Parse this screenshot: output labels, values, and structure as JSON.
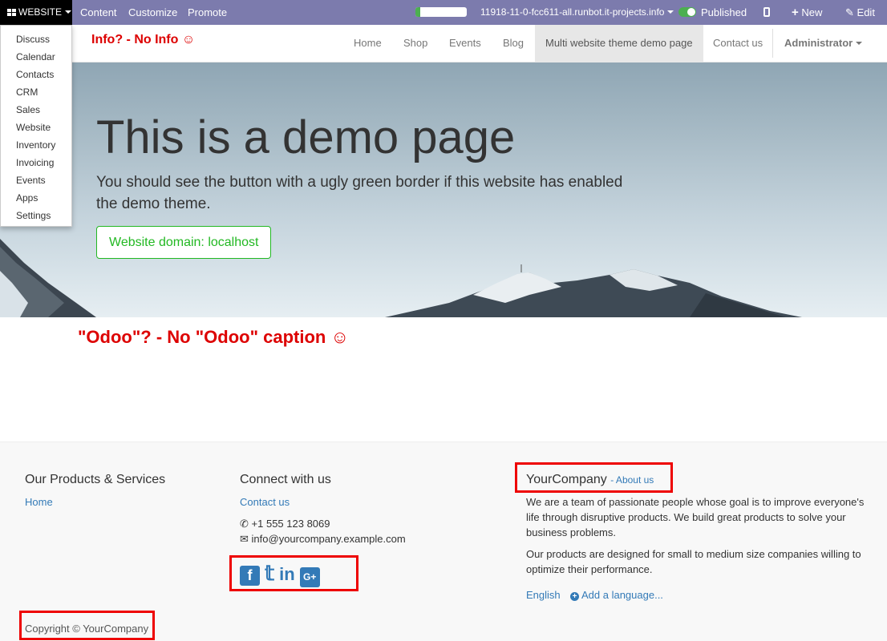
{
  "adminbar": {
    "apps_label": "WEBSITE",
    "menu": [
      "Content",
      "Customize",
      "Promote"
    ],
    "progress": 0.1,
    "domain": "11918-11-0-fcc611-all.runbot.it-projects.info",
    "published": "Published",
    "new": "New",
    "edit": "Edit"
  },
  "appmenu": [
    "Discuss",
    "Calendar",
    "Contacts",
    "CRM",
    "Sales",
    "Website",
    "Inventory",
    "Invoicing",
    "Events",
    "Apps",
    "Settings"
  ],
  "annotation_top": "Info? - No Info ☺",
  "nav": {
    "items": [
      "Home",
      "Shop",
      "Events",
      "Blog",
      "Multi website theme demo page",
      "Contact us"
    ],
    "admin": "Administrator"
  },
  "hero": {
    "title": "This is a demo page",
    "lead": "You should see the button with a ugly green border if this website has enabled the demo theme.",
    "button": "Website domain: localhost"
  },
  "annotation_middle": "\"Odoo\"? - No \"Odoo\" caption ☺",
  "footer": {
    "products_title": "Our Products & Services",
    "products_link": "Home",
    "connect_title": "Connect with us",
    "contact_link": "Contact us",
    "phone": "+1 555 123 8069",
    "email": "info@yourcompany.example.com",
    "company_title": "YourCompany",
    "about_link": "- About us",
    "about_text_1": "We are a team of passionate people whose goal is to improve everyone's life through disruptive products. We build great products to solve your business problems.",
    "about_text_2": "Our products are designed for small to medium size companies willing to optimize their performance.",
    "language": "English",
    "add_language": "Add a language...",
    "copyright": "Copyright © YourCompany"
  }
}
